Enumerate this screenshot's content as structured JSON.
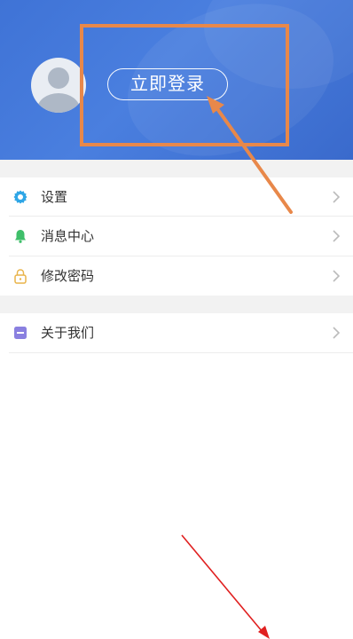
{
  "header": {
    "login_label": "立即登录",
    "bg_color": "#3f73d6"
  },
  "menu": {
    "group1": [
      {
        "label": "设置",
        "icon": "gear-icon",
        "color": "#2fa6e6"
      },
      {
        "label": "消息中心",
        "icon": "bell-icon",
        "color": "#3fbf6a"
      },
      {
        "label": "修改密码",
        "icon": "lock-icon",
        "color": "#e9b44a"
      }
    ],
    "group2": [
      {
        "label": "关于我们",
        "icon": "info-card-icon",
        "color": "#8a80e0"
      }
    ]
  },
  "annotations": {
    "box_color": "#e8884a",
    "orange_arrow_color": "#e8884a",
    "red_arrow_color": "#e02020"
  }
}
